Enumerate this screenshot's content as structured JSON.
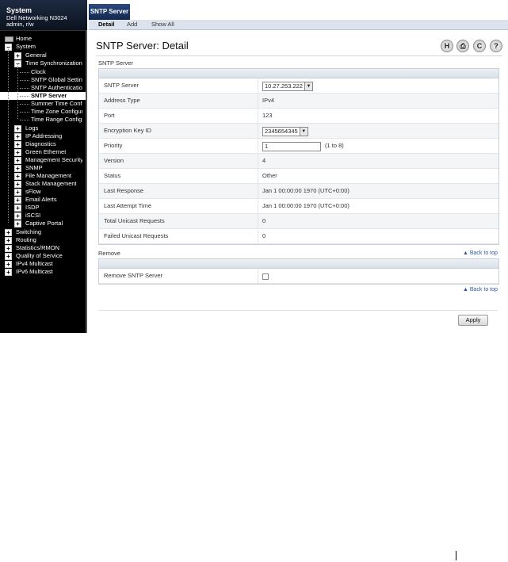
{
  "sidebar": {
    "title": "System",
    "device": "Dell Networking N3024",
    "user": "admin, r/w",
    "tree": [
      {
        "label": "Home",
        "toggle": ""
      },
      {
        "label": "System",
        "toggle": "−"
      },
      {
        "label": "General",
        "toggle": "+"
      },
      {
        "label": "Time Synchronization",
        "toggle": "−"
      },
      {
        "label": "Clock",
        "toggle": ""
      },
      {
        "label": "SNTP Global Settings",
        "toggle": ""
      },
      {
        "label": "SNTP Authentication",
        "toggle": ""
      },
      {
        "label": "SNTP Server",
        "toggle": "",
        "selected": true
      },
      {
        "label": "Summer Time Configuration",
        "toggle": ""
      },
      {
        "label": "Time Zone Configuration",
        "toggle": ""
      },
      {
        "label": "Time Range Configuration",
        "toggle": ""
      },
      {
        "label": "Logs",
        "toggle": "+"
      },
      {
        "label": "IP Addressing",
        "toggle": "+"
      },
      {
        "label": "Diagnostics",
        "toggle": "+"
      },
      {
        "label": "Green Ethernet",
        "toggle": "+"
      },
      {
        "label": "Management Security",
        "toggle": "+"
      },
      {
        "label": "SNMP",
        "toggle": "+"
      },
      {
        "label": "File Management",
        "toggle": "+"
      },
      {
        "label": "Stack Management",
        "toggle": "+"
      },
      {
        "label": "sFlow",
        "toggle": "+"
      },
      {
        "label": "Email Alerts",
        "toggle": "+"
      },
      {
        "label": "ISDP",
        "toggle": "+"
      },
      {
        "label": "iSCSI",
        "toggle": "+"
      },
      {
        "label": "Captive Portal",
        "toggle": "+"
      },
      {
        "label": "Switching",
        "toggle": "+"
      },
      {
        "label": "Routing",
        "toggle": "+"
      },
      {
        "label": "Statistics/RMON",
        "toggle": "+"
      },
      {
        "label": "Quality of Service",
        "toggle": "+"
      },
      {
        "label": "IPv4 Multicast",
        "toggle": "+"
      },
      {
        "label": "IPv6 Multicast",
        "toggle": "+"
      }
    ]
  },
  "tabs": {
    "main": "SNTP Server",
    "sub": [
      "Detail",
      "Add",
      "Show All"
    ]
  },
  "page": {
    "title": "SNTP Server: Detail",
    "icons": [
      "save-icon",
      "print-icon",
      "refresh-icon",
      "help-icon"
    ],
    "icon_glyphs": [
      "H",
      "⎙",
      "C",
      "?"
    ]
  },
  "sntp": {
    "section_label": "SNTP Server",
    "rows": [
      {
        "label": "SNTP Server",
        "value": "10.27.253.222"
      },
      {
        "label": "Address Type",
        "value": "IPv4"
      },
      {
        "label": "Port",
        "value": "123"
      },
      {
        "label": "Encryption Key ID",
        "value": "2345654345"
      },
      {
        "label": "Priority",
        "value": "1",
        "hint": "(1 to 8)"
      },
      {
        "label": "Version",
        "value": "4"
      },
      {
        "label": "Status",
        "value": "Other"
      },
      {
        "label": "Last Response",
        "value": "Jan 1 00:00:00 1970 (UTC+0:00)"
      },
      {
        "label": "Last Attempt Time",
        "value": "Jan 1 00:00:00 1970 (UTC+0:00)"
      },
      {
        "label": "Total Unicast Requests",
        "value": "0"
      },
      {
        "label": "Failed Unicast Requests",
        "value": "0"
      }
    ]
  },
  "remove": {
    "section_label": "Remove",
    "back_to_top": "Back to top",
    "row_label": "Remove SNTP Server",
    "back_to_top_2": "Back to top"
  },
  "apply_label": "Apply"
}
